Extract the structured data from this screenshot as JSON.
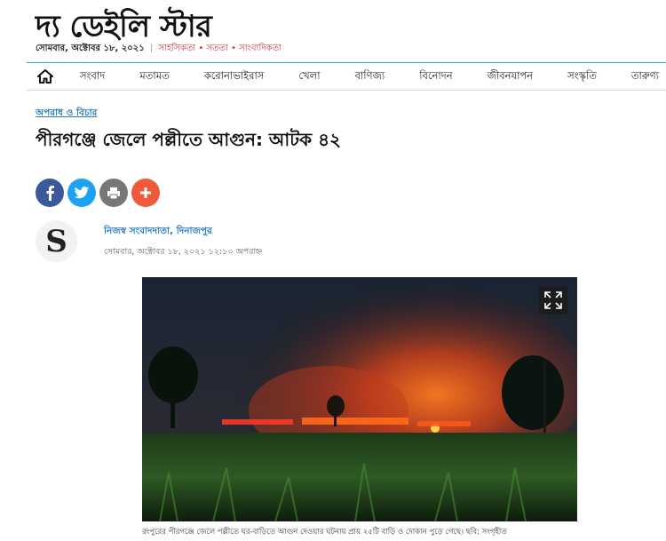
{
  "site": {
    "logo_text": "দ্য ডেইলি স্টার",
    "date": "সোমবার, অক্টোবর ১৮, ২০২১",
    "separator": "|",
    "motto": "সাহসিকতা • সততা • সাংবাদিকতা"
  },
  "nav": {
    "items": [
      "সংবাদ",
      "মতামত",
      "করোনাভাইরাস",
      "খেলা",
      "বাণিজ্য",
      "বিনোদন",
      "জীবনযাপন",
      "সংস্কৃতি",
      "তারুণ্য"
    ]
  },
  "article": {
    "category": "অপরাধ ও বিচার",
    "headline": "পীরগঞ্জে জেলে পল্লীতে আগুন: আটক ৪২",
    "avatar_letter": "S",
    "author": "নিজস্ব সংবাদদাতা, দিনাজপুর",
    "published": "সোমবার, অক্টোবর ১৮, ২০২১ ১২:১০ অপরাহ্ন",
    "caption": "রংপুরের পীরগঞ্জে জেলে পল্লীতে ঘর-বাড়িতে আগুন দেওয়ার ঘটনায় প্রায় ২৫টি বাড়ি ও দোকান পুড়ে গেছে। ছবি: সংগৃহীত"
  },
  "share": [
    {
      "name": "facebook",
      "color": "#3b5998",
      "glyph": "f"
    },
    {
      "name": "twitter",
      "color": "#1da1f2",
      "glyph": "t"
    },
    {
      "name": "print",
      "color": "#777777",
      "glyph": "print"
    },
    {
      "name": "more",
      "color": "#ef5a3c",
      "glyph": "+"
    }
  ]
}
